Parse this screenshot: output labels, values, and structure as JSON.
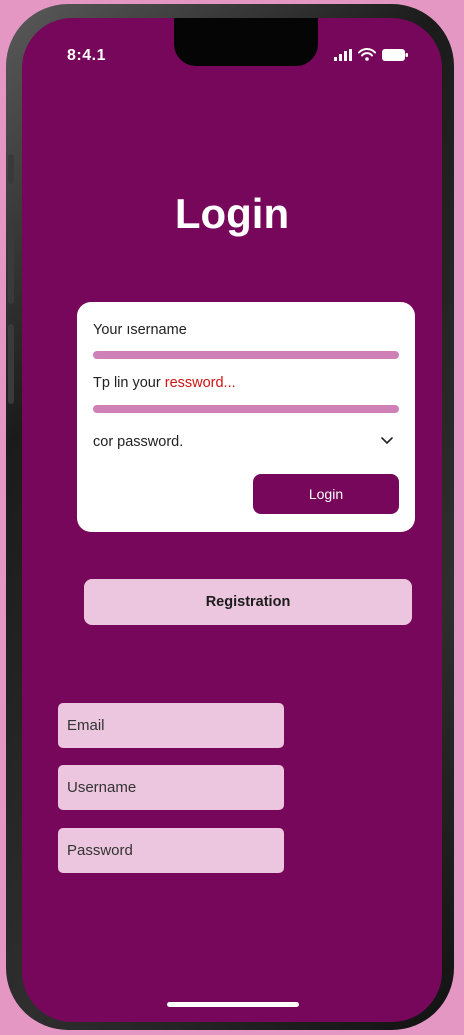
{
  "status_bar": {
    "time": "8:4.1",
    "icons": [
      "signal-icon",
      "wifi-icon",
      "battery-icon"
    ]
  },
  "screen": {
    "title": "Login"
  },
  "login_card": {
    "username_label": "Your ısername",
    "password_hint_prefix": "Tp lin your ",
    "password_hint_highlight": "ressword...",
    "confirm_label": "cor password.",
    "login_button": "Login"
  },
  "registration": {
    "button": "Registration",
    "fields": {
      "email": "Email",
      "username": "Username",
      "password": "Password"
    }
  },
  "colors": {
    "background": "#e597c4",
    "screen": "#76075b",
    "field": "#ecc6de",
    "line": "#cf80b6",
    "highlight": "#d21212"
  }
}
